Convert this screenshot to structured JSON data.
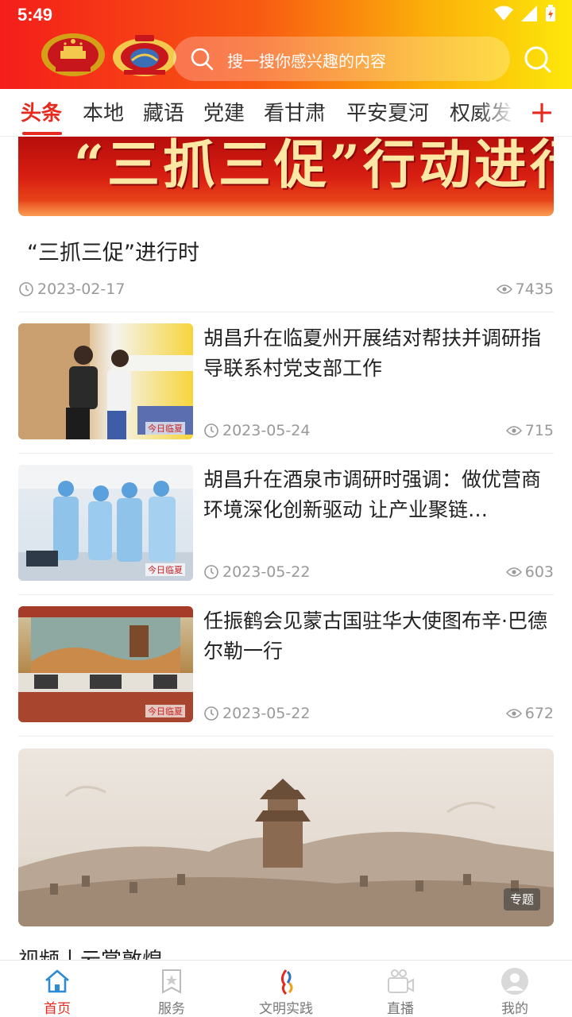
{
  "status_bar": {
    "time": "5:49"
  },
  "search": {
    "placeholder": "搜一搜你感兴趣的内容"
  },
  "tabs": [
    {
      "label": "头条",
      "active": true
    },
    {
      "label": "本地"
    },
    {
      "label": "藏语"
    },
    {
      "label": "党建"
    },
    {
      "label": "看甘肃"
    },
    {
      "label": "平安夏河"
    },
    {
      "label": "权威发"
    }
  ],
  "tab_add": "+",
  "banner": {
    "text": "“三抓三促”行动进行时"
  },
  "feature": {
    "title": "“三抓三促”进行时",
    "date": "2023-02-17",
    "views": "7435"
  },
  "news": [
    {
      "title": "胡昌升在临夏州开展结对帮扶并调研指导联系村党支部工作",
      "date": "2023-05-24",
      "views": "715",
      "watermark": "今日临夏"
    },
    {
      "title": "胡昌升在酒泉市调研时强调：做优营商环境深化创新驱动 让产业聚链…",
      "date": "2023-05-22",
      "views": "603",
      "watermark": "今日临夏"
    },
    {
      "title": "任振鹤会见蒙古国驻华大使图布辛·巴德尔勒一行",
      "date": "2023-05-22",
      "views": "672",
      "watermark": "今日临夏"
    }
  ],
  "topic_banner": {
    "badge": "专题"
  },
  "video_section": {
    "title": "视频丨云赏敦煌"
  },
  "bottom_nav": [
    {
      "label": "首页",
      "icon": "home-icon",
      "active": true
    },
    {
      "label": "服务",
      "icon": "service-icon"
    },
    {
      "label": "文明实践",
      "icon": "civilization-practice-icon"
    },
    {
      "label": "直播",
      "icon": "live-camera-icon"
    },
    {
      "label": "我的",
      "icon": "profile-icon"
    }
  ],
  "colors": {
    "accent": "#e62a1f",
    "header_start": "#f41d1a",
    "header_end": "#fde80a",
    "meta_text": "#999999"
  }
}
